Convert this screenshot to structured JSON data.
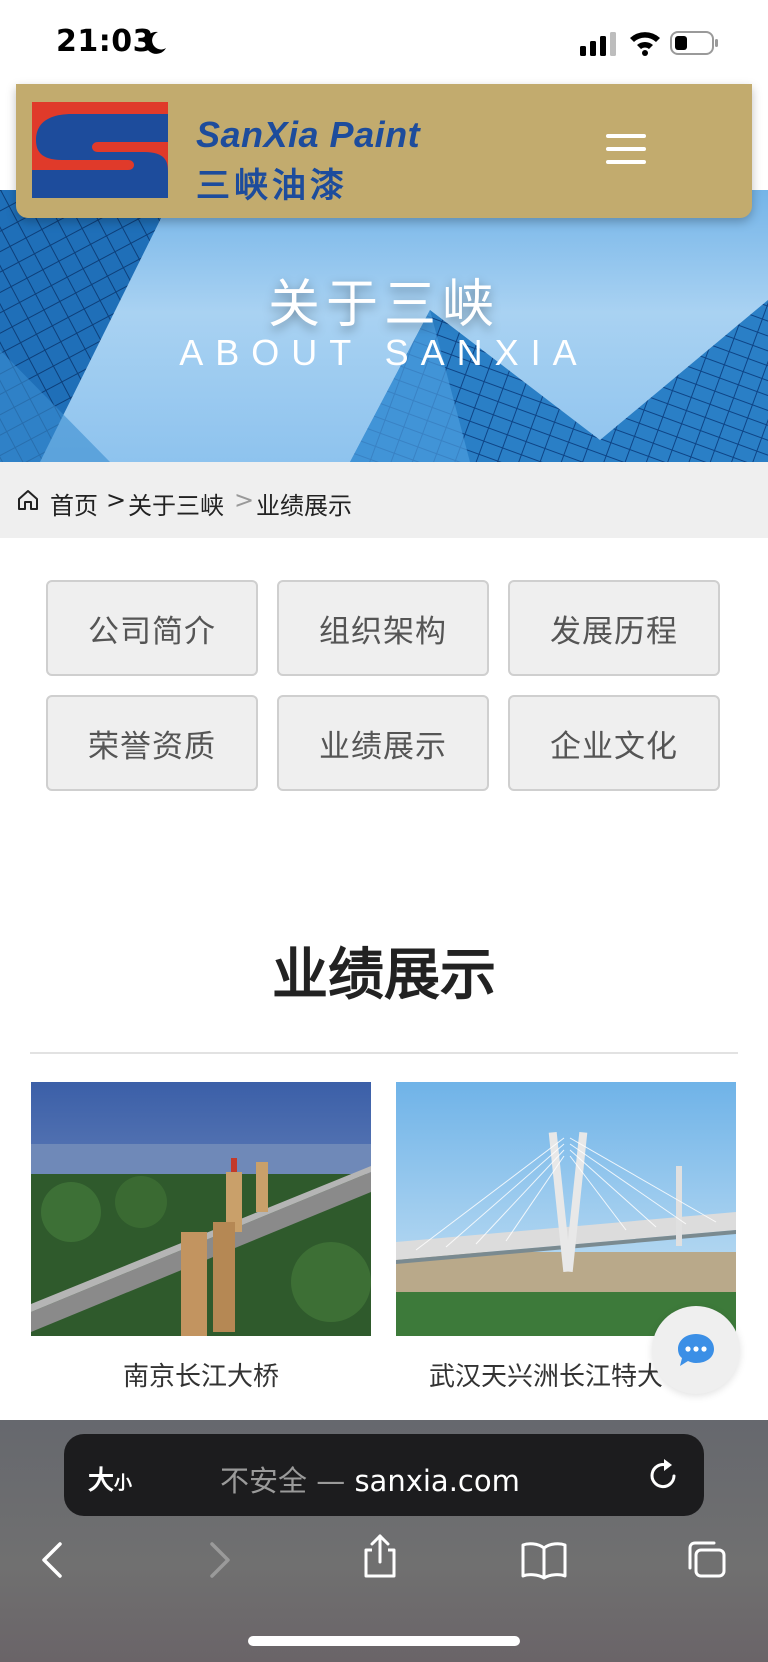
{
  "status_bar": {
    "time": "21:03"
  },
  "header": {
    "logo_en": "SanXia Paint",
    "logo_cn": "三峡油漆",
    "brand_colors": {
      "gold": "#c2ab6e",
      "blue": "#1d4c9c",
      "red": "#e03a2a"
    }
  },
  "hero": {
    "title": "关于三峡",
    "subtitle": "ABOUT SANXIA"
  },
  "breadcrumb": {
    "home": "首页",
    "sep1": ">",
    "parent": "关于三峡",
    "sep2": ">",
    "current": "业绩展示"
  },
  "nav": {
    "items": [
      {
        "label": "公司简介"
      },
      {
        "label": "组织架构"
      },
      {
        "label": "发展历程"
      },
      {
        "label": "荣誉资质"
      },
      {
        "label": "业绩展示"
      },
      {
        "label": "企业文化"
      }
    ]
  },
  "section": {
    "title": "业绩展示"
  },
  "projects": [
    {
      "label": "南京长江大桥"
    },
    {
      "label": "武汉天兴洲长江特大"
    }
  ],
  "browser": {
    "text_size_big": "大",
    "text_size_small": "小",
    "url_prefix": "不安全 — ",
    "url": "sanxia.com"
  }
}
